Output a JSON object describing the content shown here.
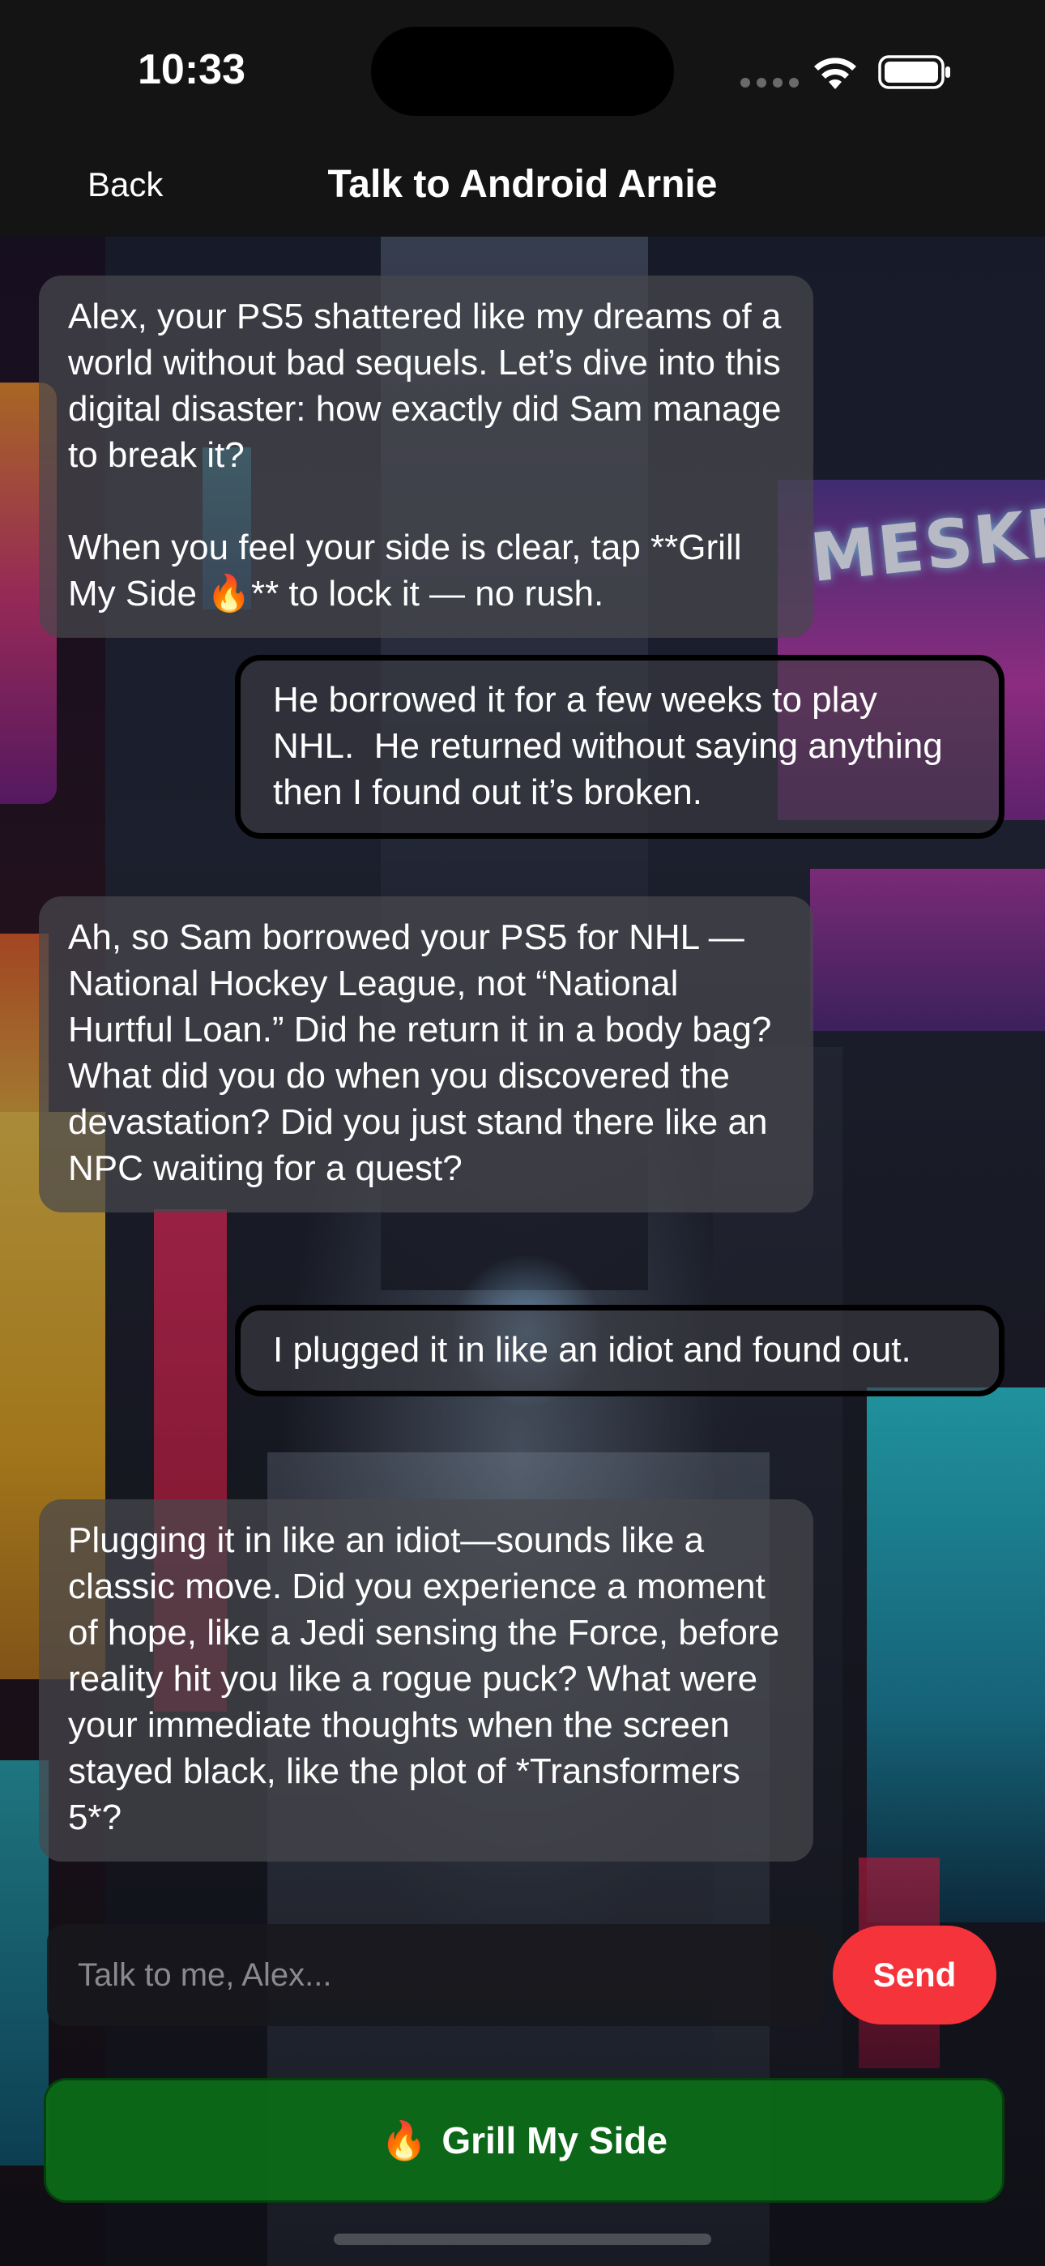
{
  "status_bar": {
    "time": "10:33"
  },
  "header": {
    "back_label": "Back",
    "title": "Talk to Android Arnie"
  },
  "background": {
    "sign_text": "MESKER"
  },
  "messages": [
    {
      "role": "bot",
      "text": "Alex, your PS5 shattered like my dreams of a world without bad sequels. Let’s dive into this digital disaster: how exactly did Sam manage to break it?\n\nWhen you feel your side is clear, tap **Grill My Side 🔥** to lock it — no rush."
    },
    {
      "role": "user",
      "text": "He borrowed it for a few weeks to play NHL.  He returned without saying anything then I found out it’s broken."
    },
    {
      "role": "bot",
      "text": "Ah, so Sam borrowed your PS5 for NHL —National Hockey League, not “National Hurtful Loan.” Did he return it in a body bag? What did you do when you discovered the devastation? Did you just stand there like an NPC waiting for a quest?"
    },
    {
      "role": "user",
      "text": "I plugged it in like an idiot and found out."
    },
    {
      "role": "bot",
      "text": "Plugging it in like an idiot—sounds like a classic move. Did you experience a moment of hope, like a Jedi sensing the Force, before reality hit you like a rogue puck? What were your immediate thoughts when the screen stayed black, like the plot of *Transformers 5*?"
    }
  ],
  "composer": {
    "placeholder": "Talk to me, Alex...",
    "value": "",
    "send_label": "Send"
  },
  "grill_button": {
    "icon": "🔥",
    "label": "Grill My Side"
  },
  "colors": {
    "send": "#f4333a",
    "grill": "#0c6e18",
    "header_bg": "#141414"
  }
}
